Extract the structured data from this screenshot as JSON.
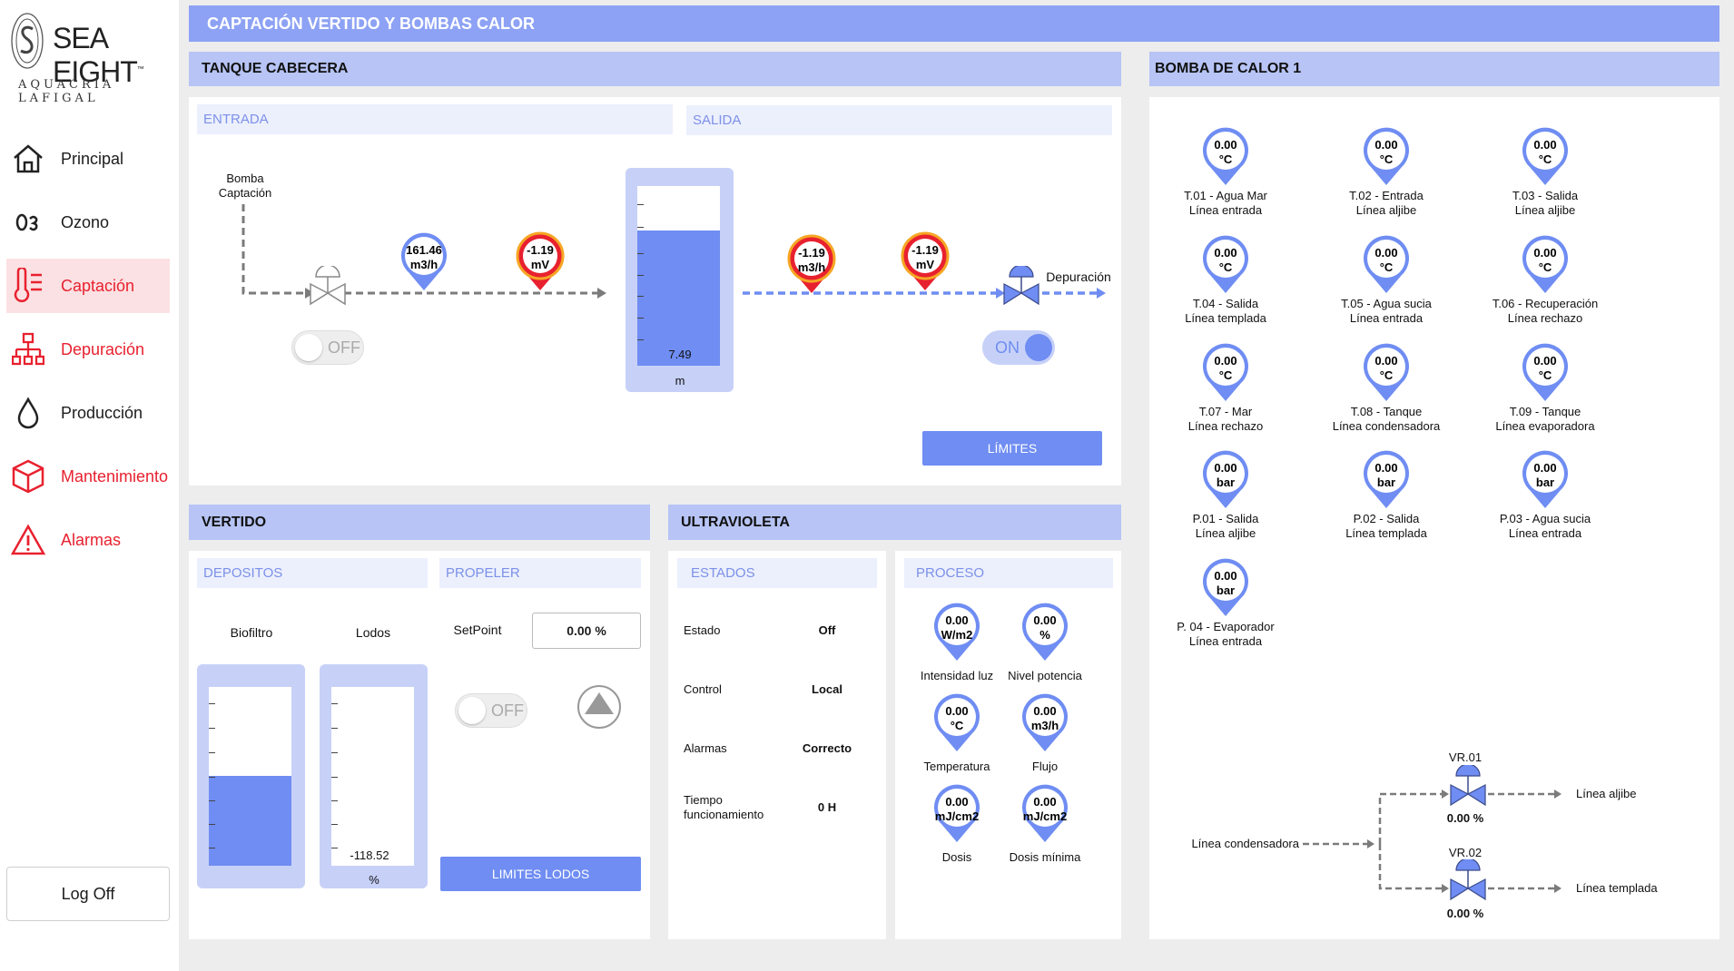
{
  "brand": {
    "name": "SEA EIGHT",
    "tm": "™",
    "subtitle": "AQUACRÍA LAFIGAL"
  },
  "nav": [
    {
      "label": "Principal",
      "icon": "home-icon"
    },
    {
      "label": "Ozono",
      "icon": "ozone-icon"
    },
    {
      "label": "Captación",
      "icon": "thermometer-icon",
      "active": true
    },
    {
      "label": "Depuración",
      "icon": "network-icon"
    },
    {
      "label": "Producción",
      "icon": "drop-icon"
    },
    {
      "label": "Mantenimiento",
      "icon": "cube-icon"
    },
    {
      "label": "Alarmas",
      "icon": "warning-icon"
    }
  ],
  "logoff": "Log Off",
  "page_title": "CAPTACIÓN VERTIDO Y BOMBAS CALOR",
  "tanque": {
    "title": "TANQUE CABECERA",
    "entrada": "ENTRADA",
    "salida": "SALIDA",
    "bomba_line1": "Bomba",
    "bomba_line2": "Captación",
    "flow_value": "161.46",
    "flow_unit": "m3/h",
    "mv_in_value": "-1.19",
    "mv_in_unit": "mV",
    "out1_value": "-1.19",
    "out1_unit": "m3/h",
    "out2_value": "-1.19",
    "out2_unit": "mV",
    "toggle_in": "OFF",
    "toggle_out": "ON",
    "depuracion": "Depuración",
    "tank_value": "7.49",
    "tank_unit": "m",
    "tank_level": 0.75,
    "limits_btn": "LÍMITES"
  },
  "bomba": {
    "title": "BOMBA DE CALOR 1",
    "sensors": [
      {
        "value": "0.00",
        "unit": "°C",
        "l1": "T.01 - Agua Mar",
        "l2": "Línea entrada"
      },
      {
        "value": "0.00",
        "unit": "°C",
        "l1": "T.02 - Entrada",
        "l2": "Línea aljibe"
      },
      {
        "value": "0.00",
        "unit": "°C",
        "l1": "T.03 - Salida",
        "l2": "Línea aljibe"
      },
      {
        "value": "0.00",
        "unit": "°C",
        "l1": "T.04 - Salida",
        "l2": "Línea templada"
      },
      {
        "value": "0.00",
        "unit": "°C",
        "l1": "T.05 - Agua sucia",
        "l2": "Línea entrada"
      },
      {
        "value": "0.00",
        "unit": "°C",
        "l1": "T.06 - Recuperación",
        "l2": "Línea rechazo"
      },
      {
        "value": "0.00",
        "unit": "°C",
        "l1": "T.07 - Mar",
        "l2": "Línea rechazo"
      },
      {
        "value": "0.00",
        "unit": "°C",
        "l1": "T.08 - Tanque",
        "l2": "Línea condensadora"
      },
      {
        "value": "0.00",
        "unit": "°C",
        "l1": "T.09 - Tanque",
        "l2": "Línea evaporadora"
      },
      {
        "value": "0.00",
        "unit": "bar",
        "l1": "P.01 - Salida",
        "l2": "Línea aljibe"
      },
      {
        "value": "0.00",
        "unit": "bar",
        "l1": "P.02 - Salida",
        "l2": "Línea templada"
      },
      {
        "value": "0.00",
        "unit": "bar",
        "l1": "P.03 - Agua sucia",
        "l2": "Línea entrada"
      },
      {
        "value": "0.00",
        "unit": "bar",
        "l1": "P. 04 - Evaporador",
        "l2": "Línea entrada"
      }
    ],
    "vr01": "VR.01",
    "vr01_val": "0.00 %",
    "vr02": "VR.02",
    "vr02_val": "0.00 %",
    "linea_aljibe": "Línea aljibe",
    "linea_templada": "Línea templada",
    "linea_condensadora": "Línea condensadora"
  },
  "vertido": {
    "title": "VERTIDO",
    "depositos": "DEPOSITOS",
    "propeler": "PROPELER",
    "biofiltro": "Biofiltro",
    "lodos": "Lodos",
    "biofiltro_level": 0.5,
    "lodos_value": "-118.52",
    "lodos_unit": "%",
    "setpoint_label": "SetPoint",
    "setpoint_value": "0.00 %",
    "toggle": "OFF",
    "limites_btn": "LIMITES LODOS"
  },
  "uv": {
    "title": "ULTRAVIOLETA",
    "estados": "ESTADOS",
    "proceso": "PROCESO",
    "rows": [
      {
        "label": "Estado",
        "value": "Off"
      },
      {
        "label": "Control",
        "value": "Local"
      },
      {
        "label": "Alarmas",
        "value": "Correcto"
      },
      {
        "label": "Tiempo funcionamiento",
        "value": "0 H"
      }
    ],
    "gauges": [
      {
        "value": "0.00",
        "unit": "W/m2",
        "label": "Intensidad luz"
      },
      {
        "value": "0.00",
        "unit": "%",
        "label": "Nivel potencia"
      },
      {
        "value": "0.00",
        "unit": "°C",
        "label": "Temperatura"
      },
      {
        "value": "0.00",
        "unit": "m3/h",
        "label": "Flujo"
      },
      {
        "value": "0.00",
        "unit": "mJ/cm2",
        "label": "Dosis"
      },
      {
        "value": "0.00",
        "unit": "mJ/cm2",
        "label": "Dosis mínima"
      }
    ]
  }
}
